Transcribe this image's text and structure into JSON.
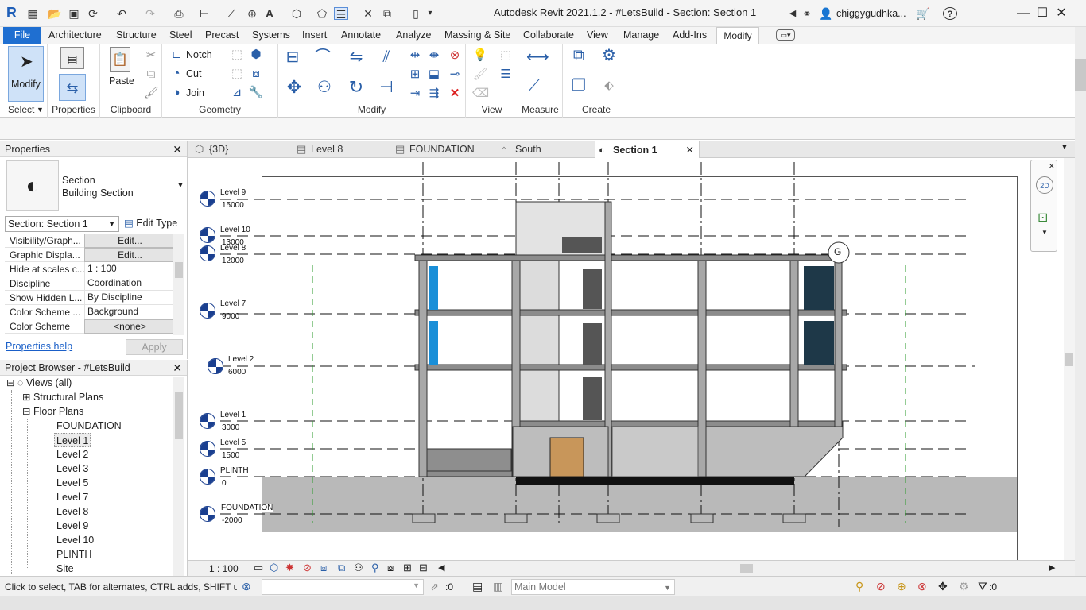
{
  "app": {
    "title": "Autodesk Revit 2021.1.2 - #LetsBuild - Section: Section 1",
    "user": "chiggygudhka...",
    "logo": "R"
  },
  "menu": {
    "file": "File",
    "tabs": [
      "Architecture",
      "Structure",
      "Steel",
      "Precast",
      "Systems",
      "Insert",
      "Annotate",
      "Analyze",
      "Massing & Site",
      "Collaborate",
      "View",
      "Manage",
      "Add-Ins",
      "Modify"
    ]
  },
  "ribbon": {
    "select": {
      "modify": "Modify",
      "label": "Select"
    },
    "properties": {
      "label": "Properties"
    },
    "clipboard": {
      "paste": "Paste",
      "label": "Clipboard"
    },
    "geometry": {
      "notch": "Notch",
      "cut": "Cut",
      "join": "Join",
      "label": "Geometry"
    },
    "modify": {
      "label": "Modify"
    },
    "view": {
      "label": "View"
    },
    "measure": {
      "label": "Measure"
    },
    "create": {
      "label": "Create"
    }
  },
  "properties": {
    "header": "Properties",
    "type_line1": "Section",
    "type_line2": "Building Section",
    "selector": "Section: Section 1",
    "edit_type": "Edit Type",
    "rows": [
      {
        "k": "Visibility/Graph...",
        "v": "Edit..."
      },
      {
        "k": "Graphic Displa...",
        "v": "Edit..."
      },
      {
        "k": "Hide at scales c...",
        "v": "1 : 100"
      },
      {
        "k": "Discipline",
        "v": "Coordination"
      },
      {
        "k": "Show Hidden L...",
        "v": "By Discipline"
      },
      {
        "k": "Color Scheme ...",
        "v": "Background"
      },
      {
        "k": "Color Scheme",
        "v": "<none>"
      }
    ],
    "help": "Properties help",
    "apply": "Apply"
  },
  "browser": {
    "header": "Project Browser - #LetsBuild",
    "views": "Views (all)",
    "structural": "Structural Plans",
    "floor": "Floor Plans",
    "items": [
      "FOUNDATION",
      "Level 1",
      "Level 2",
      "Level 3",
      "Level 5",
      "Level 7",
      "Level 8",
      "Level 9",
      "Level 10",
      "PLINTH",
      "Site"
    ]
  },
  "tabs": [
    {
      "label": "{3D}",
      "icon": "3d-view-icon"
    },
    {
      "label": "Level 8",
      "icon": "floor-plan-icon"
    },
    {
      "label": "FOUNDATION",
      "icon": "floor-plan-icon"
    },
    {
      "label": "South",
      "icon": "elevation-icon"
    },
    {
      "label": "Section 1",
      "icon": "section-icon"
    }
  ],
  "levels": [
    {
      "name": "Level 9",
      "elev": "15000"
    },
    {
      "name": "Level 10",
      "elev": "13000"
    },
    {
      "name": "Level 8",
      "elev": "12000"
    },
    {
      "name": "Level 7",
      "elev": "9000"
    },
    {
      "name": "Level 2",
      "elev": "6000"
    },
    {
      "name": "Level 1",
      "elev": "3000"
    },
    {
      "name": "Level 5",
      "elev": "1500"
    },
    {
      "name": "PLINTH",
      "elev": "0"
    },
    {
      "name": "FOUNDATION",
      "elev": "-2000"
    }
  ],
  "grid_label": "G",
  "viewbar": {
    "scale": "1 : 100"
  },
  "status": {
    "hint": "Click to select, TAB for alternates, CTRL adds, SHIFT unse",
    "count": ":0",
    "model": "Main Model",
    "filter": ":0"
  },
  "colors": {
    "accent": "#1f6fd1",
    "bubble": "#1a3f8f",
    "glass": "#1a8fd8",
    "door": "#c8965a",
    "ground": "#b9b9b9"
  }
}
